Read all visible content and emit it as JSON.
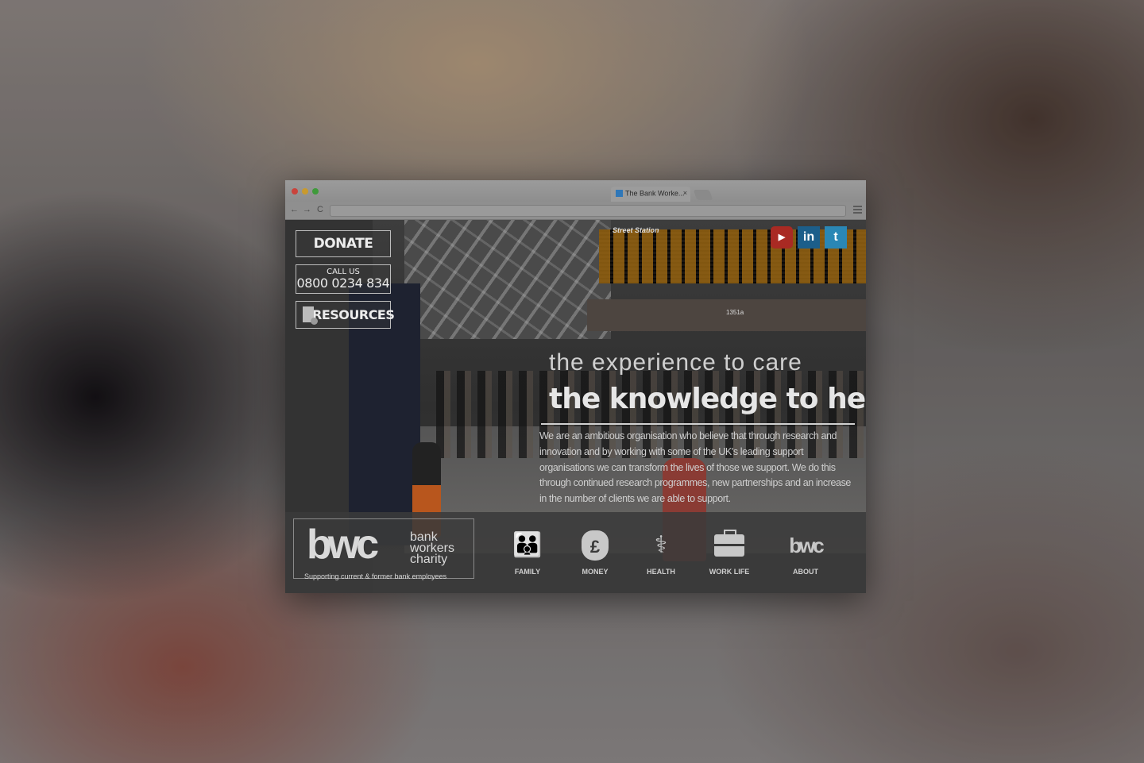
{
  "browser": {
    "tab_title": "The Bank Worke...",
    "tab_close": "×",
    "nav_back": "←",
    "nav_forward": "→",
    "nav_reload": "C"
  },
  "hero": {
    "station_sign": "Street Station",
    "board_text": "1351a",
    "donate_label": "DONATE",
    "call_label": "CALL US",
    "call_number": "0800 0234 834",
    "resources_label": "RESOURCES",
    "social": {
      "youtube": "▶",
      "linkedin": "in",
      "twitter": "t"
    },
    "headline_line1": "the experience to care",
    "headline_line2": "the knowledge to help",
    "intro": "We are an ambitious organisation who believe that through research and innovation and by working with some of the UK's leading support organisations we can transform the lives of those we support. We do this through continued research programmes, new partnerships and an increase in the number of clients we are able to support."
  },
  "footer": {
    "logo_mark": "bwc",
    "logo_line1": "bank",
    "logo_line2": "workers",
    "logo_line3": "charity",
    "tagline": "Supporting current & former bank employees",
    "nav": [
      {
        "label": "FAMILY",
        "icon": "family-icon",
        "glyph": "👪"
      },
      {
        "label": "MONEY",
        "icon": "money-bag-icon",
        "glyph": "£"
      },
      {
        "label": "HEALTH",
        "icon": "stethoscope-icon",
        "glyph": "⚕"
      },
      {
        "label": "WORK LIFE",
        "icon": "briefcase-icon",
        "glyph": ""
      },
      {
        "label": "ABOUT",
        "icon": "bwc-logo-icon",
        "glyph": "bwc"
      }
    ]
  },
  "colors": {
    "youtube": "#a92a23",
    "linkedin": "#1c5e8a",
    "twitter": "#2a87b5"
  }
}
